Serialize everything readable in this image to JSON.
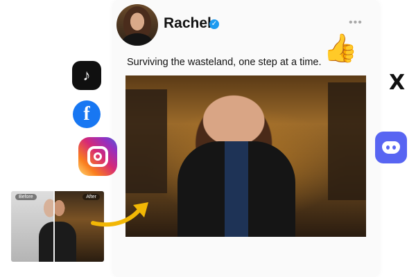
{
  "post": {
    "author": "Rachel",
    "verified_mark": "✓",
    "more_icon": "•••",
    "caption": "Surviving the wasteland, one step at a time.",
    "reaction_emoji": "👍"
  },
  "social_icons": {
    "tiktok_glyph": "♪",
    "facebook_glyph": "f",
    "x_glyph": "X"
  },
  "comparison": {
    "before_label": "Before",
    "after_label": "After"
  },
  "colors": {
    "verified": "#1d9bf0",
    "facebook": "#1877f2",
    "discord": "#5865f2",
    "arrow": "#f2b705"
  }
}
